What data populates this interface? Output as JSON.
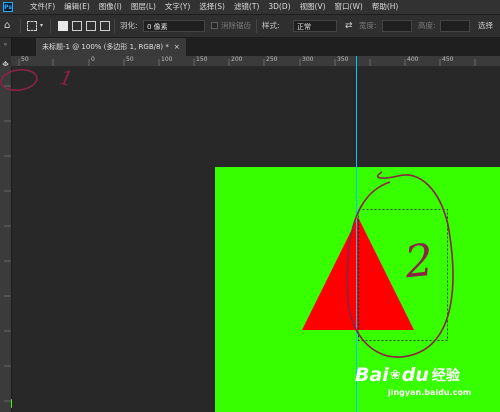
{
  "app": {
    "logo_text": "Ps"
  },
  "menu": {
    "items": [
      "文件(F)",
      "编辑(E)",
      "图像(I)",
      "图层(L)",
      "文字(Y)",
      "选择(S)",
      "滤镜(T)",
      "3D(D)",
      "视图(V)",
      "窗口(W)",
      "帮助(H)"
    ]
  },
  "options": {
    "feather_label": "羽化:",
    "feather_value": "0 像素",
    "antialias_label": "消除锯齿",
    "style_label": "样式:",
    "style_value": "正常",
    "width_label": "宽度:",
    "height_label": "高度:",
    "select_label": "选择"
  },
  "tab": {
    "title": "未标题-1 @ 100% (多边形 1, RGB/8) *",
    "close": "×"
  },
  "ruler": {
    "ticks": [
      "50",
      "0",
      "50",
      "100",
      "150",
      "200",
      "250",
      "300",
      "350",
      "400",
      "450"
    ]
  },
  "annotations": {
    "label_1": "1",
    "label_2": "2"
  },
  "watermark": {
    "brand": "Bai",
    "brand_suffix": "du",
    "cn": "经验",
    "url": "jingyan.baidu.com"
  },
  "colors": {
    "canvas_bg": "#37ff00",
    "shape_fill": "#ff0000",
    "annotation": "#8b2346",
    "guide": "#00c8ff"
  }
}
